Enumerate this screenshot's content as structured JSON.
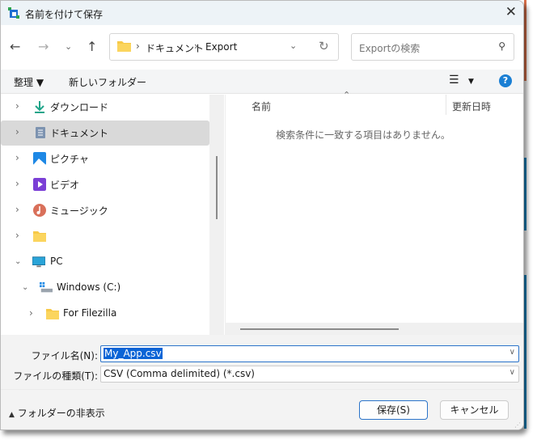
{
  "title": "名前を付けて保存",
  "nav": {
    "path": [
      "ドキュメント",
      "Export"
    ],
    "search_placeholder": "Exportの検索"
  },
  "toolbar": {
    "organize": "整理 ▼",
    "new_folder": "新しいフォルダー",
    "help": "?"
  },
  "tree": [
    {
      "label": "ダウンロード",
      "icon": "download-icon",
      "expanded": false
    },
    {
      "label": "ドキュメント",
      "icon": "documents-icon",
      "expanded": false,
      "selected": true
    },
    {
      "label": "ピクチャ",
      "icon": "pictures-icon",
      "expanded": false
    },
    {
      "label": "ビデオ",
      "icon": "videos-icon",
      "expanded": false
    },
    {
      "label": "ミュージック",
      "icon": "music-icon",
      "expanded": false
    },
    {
      "label": "",
      "icon": "folder-icon",
      "expanded": false
    },
    {
      "label": "PC",
      "icon": "pc-icon",
      "expanded": true
    },
    {
      "label": "Windows (C:)",
      "icon": "drive-icon",
      "expanded": true
    },
    {
      "label": "For Filezilla",
      "icon": "folder-icon",
      "expanded": false
    }
  ],
  "list": {
    "columns": [
      "名前",
      "更新日時"
    ],
    "empty_message": "検索条件に一致する項目はありません。"
  },
  "form": {
    "filename_label": "ファイル名(N):",
    "filename_value": "My_App.csv",
    "type_label": "ファイルの種類(T):",
    "type_value": "CSV (Comma delimited) (*.csv)"
  },
  "footer": {
    "hide_folders": "フォルダーの非表示",
    "save": "保存(S)",
    "cancel": "キャンセル"
  },
  "colors": {
    "accent": "#0a64d6",
    "selected_row": "#d9d9d9"
  }
}
